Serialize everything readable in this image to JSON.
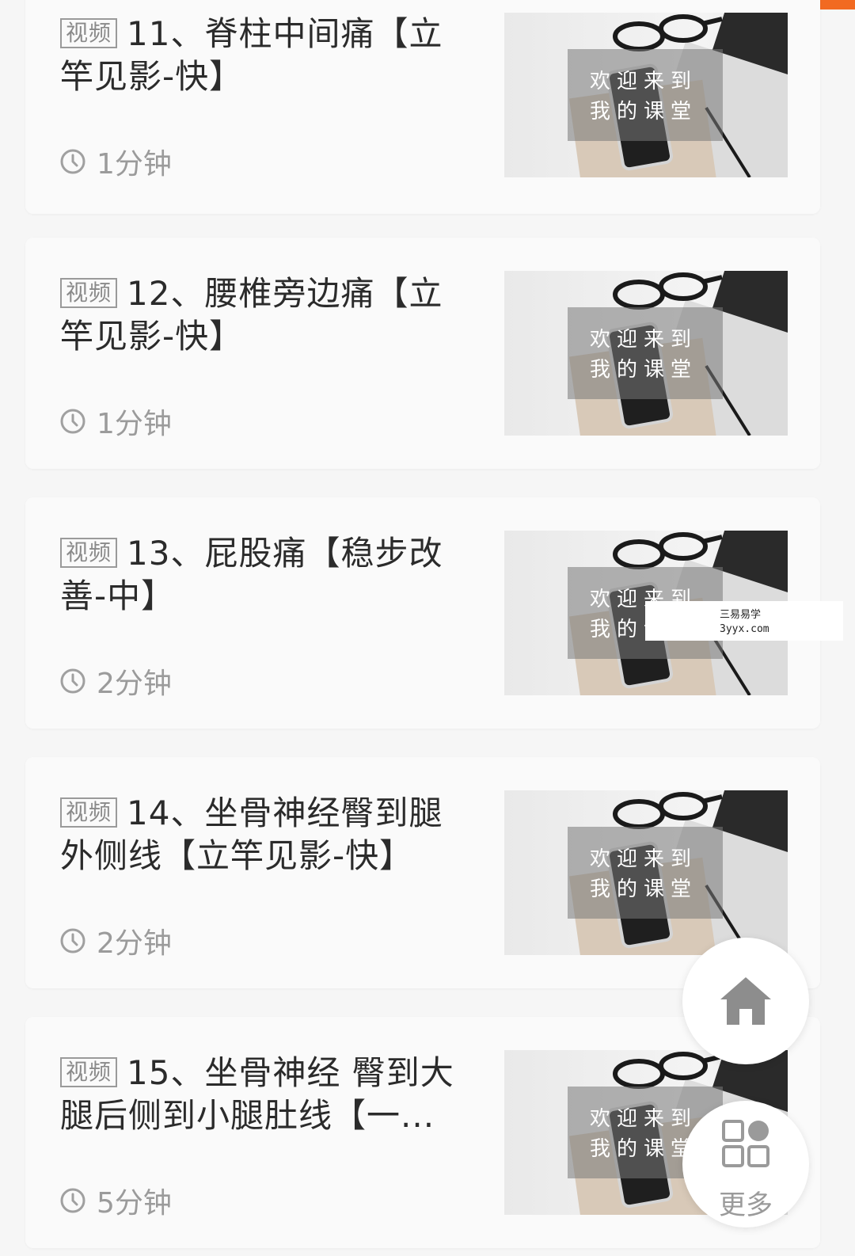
{
  "lessons": [
    {
      "tag": "视频",
      "title": "11、脊柱中间痛【立竿见影-快】",
      "duration": "1分钟",
      "thumb_line1": "欢迎来到",
      "thumb_line2": "我的课堂"
    },
    {
      "tag": "视频",
      "title": "12、腰椎旁边痛【立竿见影-快】",
      "duration": "1分钟",
      "thumb_line1": "欢迎来到",
      "thumb_line2": "我的课堂"
    },
    {
      "tag": "视频",
      "title": "13、屁股痛【稳步改善-中】",
      "duration": "2分钟",
      "thumb_line1": "欢迎来到",
      "thumb_line2": "我的课堂"
    },
    {
      "tag": "视频",
      "title": "14、坐骨神经臀到腿外侧线【立竿见影-快】",
      "duration": "2分钟",
      "thumb_line1": "欢迎来到",
      "thumb_line2": "我的课堂"
    },
    {
      "tag": "视频",
      "title": "15、坐骨神经 臀到大腿后侧到小腿肚线【一...",
      "duration": "5分钟",
      "thumb_line1": "欢迎来到",
      "thumb_line2": "我的课堂"
    }
  ],
  "watermark": {
    "line1": "三易易学",
    "line2": "3yyx.com"
  },
  "fab": {
    "home_icon": "home-icon",
    "more_icon": "grid-icon",
    "more_label": "更多"
  },
  "colors": {
    "accent": "#f26a21",
    "card_bg": "#fafafa",
    "text": "#2b2b2b",
    "muted": "#9b9b9b"
  }
}
